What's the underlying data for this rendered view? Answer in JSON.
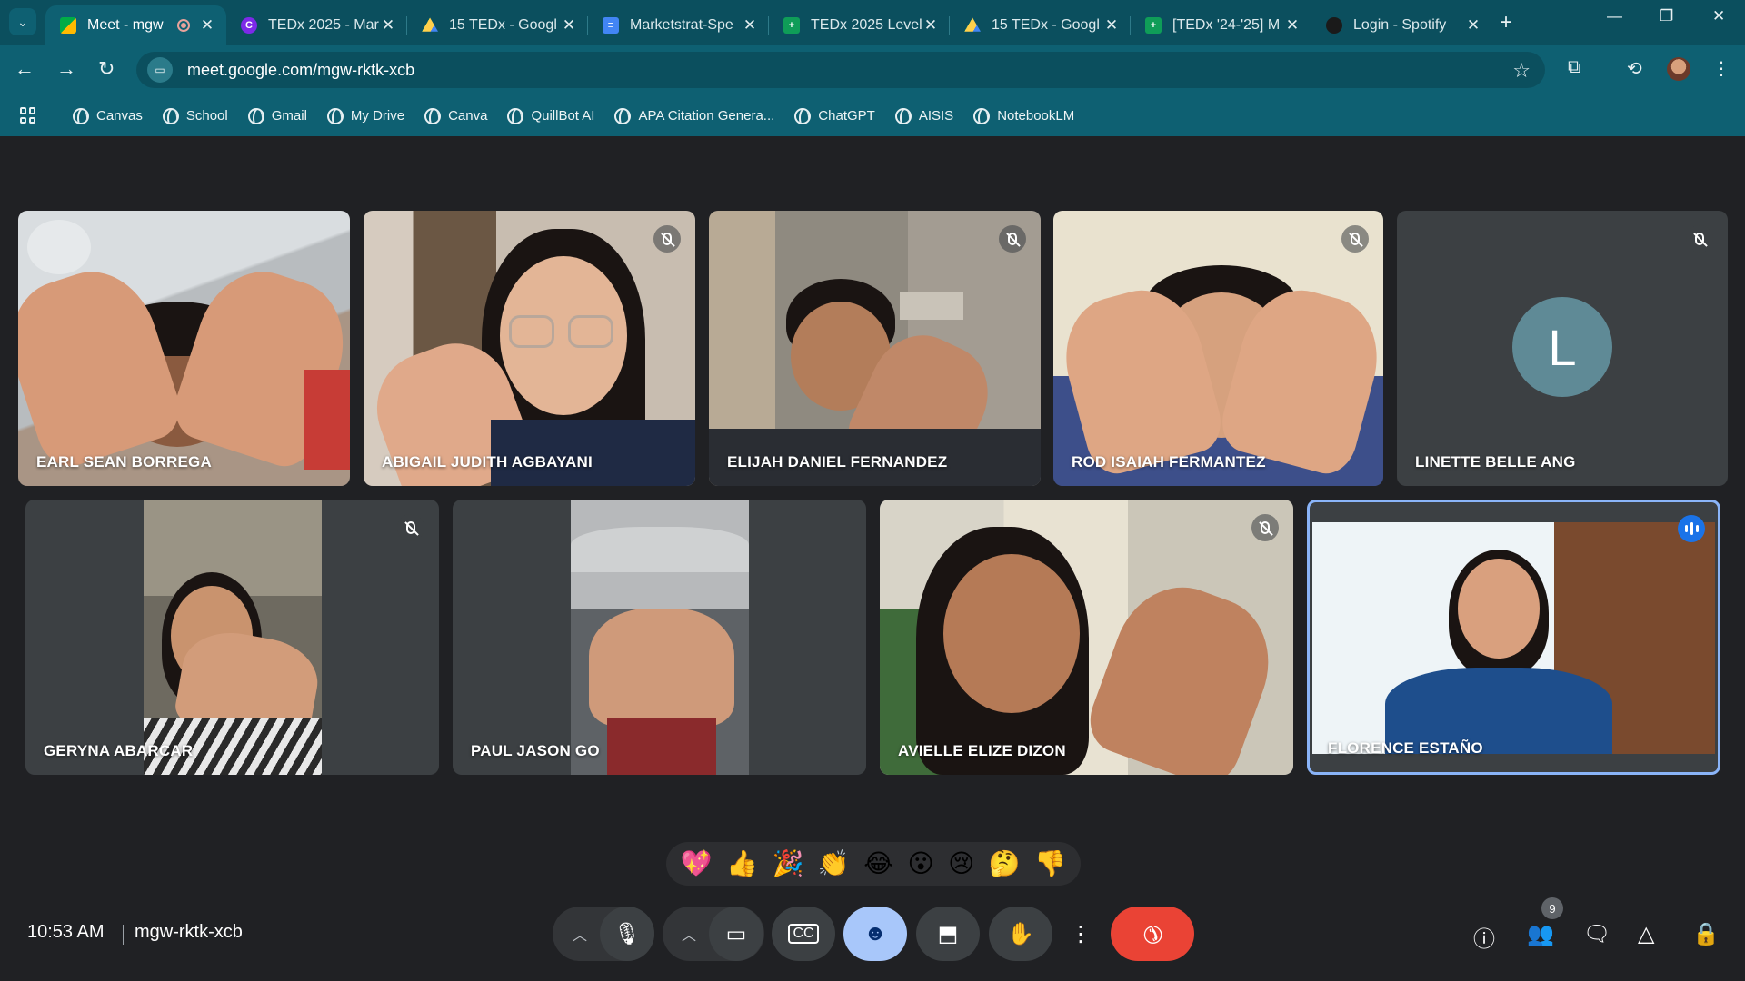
{
  "browser": {
    "tabs": [
      {
        "title": "Meet - mgw",
        "icon": "meet-icon",
        "active": true,
        "recording": true
      },
      {
        "title": "TEDx 2025 - Mar",
        "icon": "canva-icon"
      },
      {
        "title": "15 TEDx - Googl",
        "icon": "drive-icon"
      },
      {
        "title": "Marketstrat-Spe",
        "icon": "docs-icon"
      },
      {
        "title": "TEDx 2025 Level",
        "icon": "sheets-icon"
      },
      {
        "title": "15 TEDx - Googl",
        "icon": "drive-icon"
      },
      {
        "title": "[TEDx '24-'25] M",
        "icon": "sheets-icon"
      },
      {
        "title": "Login - Spotify",
        "icon": "spotify-icon"
      }
    ],
    "url": "meet.google.com/mgw-rktk-xcb",
    "bookmarks": [
      "Canvas",
      "School",
      "Gmail",
      "My Drive",
      "Canva",
      "QuillBot AI",
      "APA Citation Genera...",
      "ChatGPT",
      "AISIS",
      "NotebookLM"
    ]
  },
  "meet": {
    "participants": [
      {
        "name": "EARL SEAN BORREGA",
        "muted": false
      },
      {
        "name": "ABIGAIL JUDITH AGBAYANI",
        "muted": true
      },
      {
        "name": "ELIJAH DANIEL FERNANDEZ",
        "muted": true
      },
      {
        "name": "ROD ISAIAH FERMANTEZ",
        "muted": true
      },
      {
        "name": "LINETTE BELLE ANG",
        "muted": true,
        "avatar_letter": "L"
      },
      {
        "name": "GERYNA ABARCAR",
        "muted": true
      },
      {
        "name": "PAUL JASON GO",
        "muted": false
      },
      {
        "name": "AVIELLE ELIZE DIZON",
        "muted": true
      },
      {
        "name": "FLORENCE ESTAÑO",
        "muted": false,
        "speaking": true
      }
    ],
    "reactions": [
      "💖",
      "👍",
      "🎉",
      "👏",
      "😂",
      "😮",
      "😢",
      "🤔",
      "👎"
    ],
    "time": "10:53 AM",
    "meeting_code": "mgw-rktk-xcb",
    "participant_count": "9"
  },
  "colors": {
    "tabstrip": "#0b4f5e",
    "toolbar": "#0e6072",
    "stage": "#202124",
    "hangup": "#ea4335",
    "active_control": "#a8c7fa",
    "speaking_border": "#8ab4f8"
  }
}
